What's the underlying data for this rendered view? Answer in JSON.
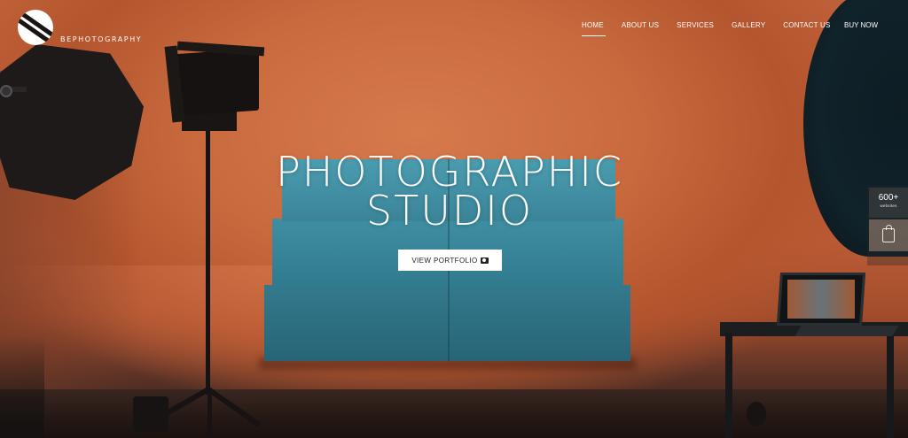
{
  "brand": {
    "name": "BEPHOTOGRAPHY"
  },
  "nav": {
    "items": [
      {
        "label": "HOME",
        "active": true
      },
      {
        "label": "ABOUT US",
        "active": false
      },
      {
        "label": "SERVICES",
        "active": false
      },
      {
        "label": "GALLERY",
        "active": false
      },
      {
        "label": "CONTACT US",
        "active": false
      }
    ],
    "cta": "BUY NOW"
  },
  "hero": {
    "headline_line1": "PHOTOGRAPHIC",
    "headline_line2": "STUDIO",
    "button_label": "VIEW PORTFOLIO",
    "button_icon": "camera-icon"
  },
  "side_widgets": {
    "websites_count": "600+",
    "websites_label": "websites",
    "cart_icon": "shopping-bag-icon"
  },
  "colors": {
    "backdrop": "#c86a3e",
    "platform": "#3a8498",
    "text": "#ffffff",
    "button_bg": "#ffffff"
  }
}
